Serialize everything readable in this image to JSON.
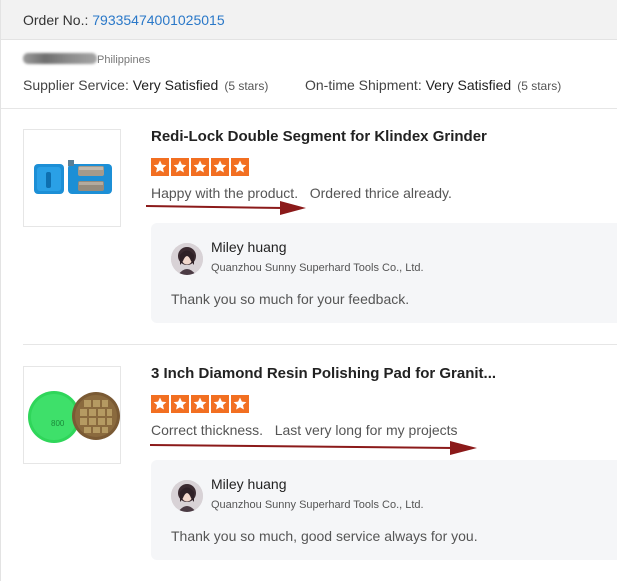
{
  "order": {
    "label": "Order No.: ",
    "number": "79335474001025015"
  },
  "buyer": {
    "location": "Philippines"
  },
  "ratings": {
    "supplier_label": "Supplier Service: ",
    "supplier_value": "Very Satisfied",
    "supplier_stars_note": "(5 stars)",
    "shipment_label": "On-time Shipment: ",
    "shipment_value": "Very Satisfied",
    "shipment_stars_note": "(5 stars)"
  },
  "accent_colors": {
    "stars": "#f26f21",
    "link": "#2a78c8",
    "arrow": "#8b1a1a"
  },
  "reviews": [
    {
      "product_title": "Redi-Lock Double Segment for Klindex Grinder",
      "rating": 5,
      "text": "Happy with the product.   Ordered thrice already.",
      "thumbnail_icon": "blue-grinding-segment-image",
      "reply": {
        "name": "Miley huang",
        "company": "Quanzhou Sunny Superhard Tools Co., Ltd.",
        "text": "Thank you so much for your feedback."
      }
    },
    {
      "product_title": "3 Inch Diamond Resin Polishing Pad for Granit...",
      "rating": 5,
      "text": "Correct thickness.   Last very long for my projects",
      "thumbnail_icon": "green-polishing-pad-image",
      "thumbnail_pad_label": "800",
      "reply": {
        "name": "Miley huang",
        "company": "Quanzhou Sunny Superhard Tools Co., Ltd.",
        "text": "Thank you so much, good service always for you."
      }
    }
  ]
}
